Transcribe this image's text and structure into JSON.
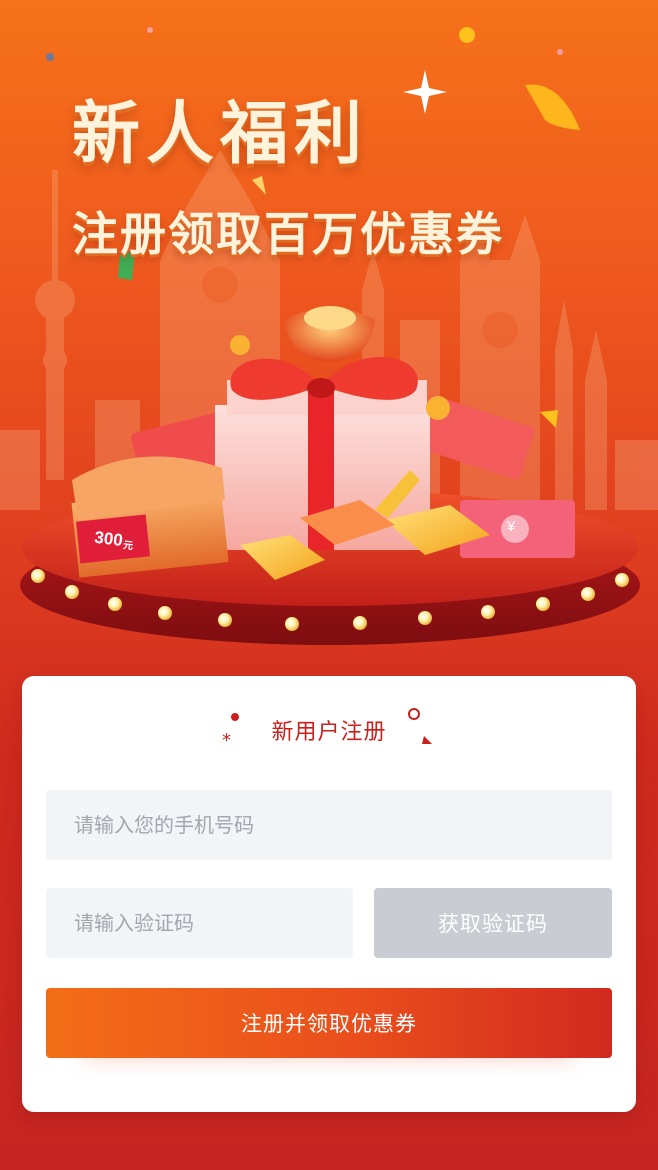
{
  "hero": {
    "headline": "新人福利",
    "subheadline": "注册领取百万优惠券",
    "coupon_amount": "300",
    "coupon_unit": "元",
    "money_symbol": "¥"
  },
  "form": {
    "title": "新用户注册",
    "phone_placeholder": "请输入您的手机号码",
    "code_placeholder": "请输入验证码",
    "get_code_label": "获取验证码",
    "submit_label": "注册并领取优惠券"
  },
  "colors": {
    "brand_orange": "#f36d17",
    "brand_red": "#c8201c",
    "input_bg": "#f2f4f7",
    "disabled_button": "#c9ccd2"
  }
}
